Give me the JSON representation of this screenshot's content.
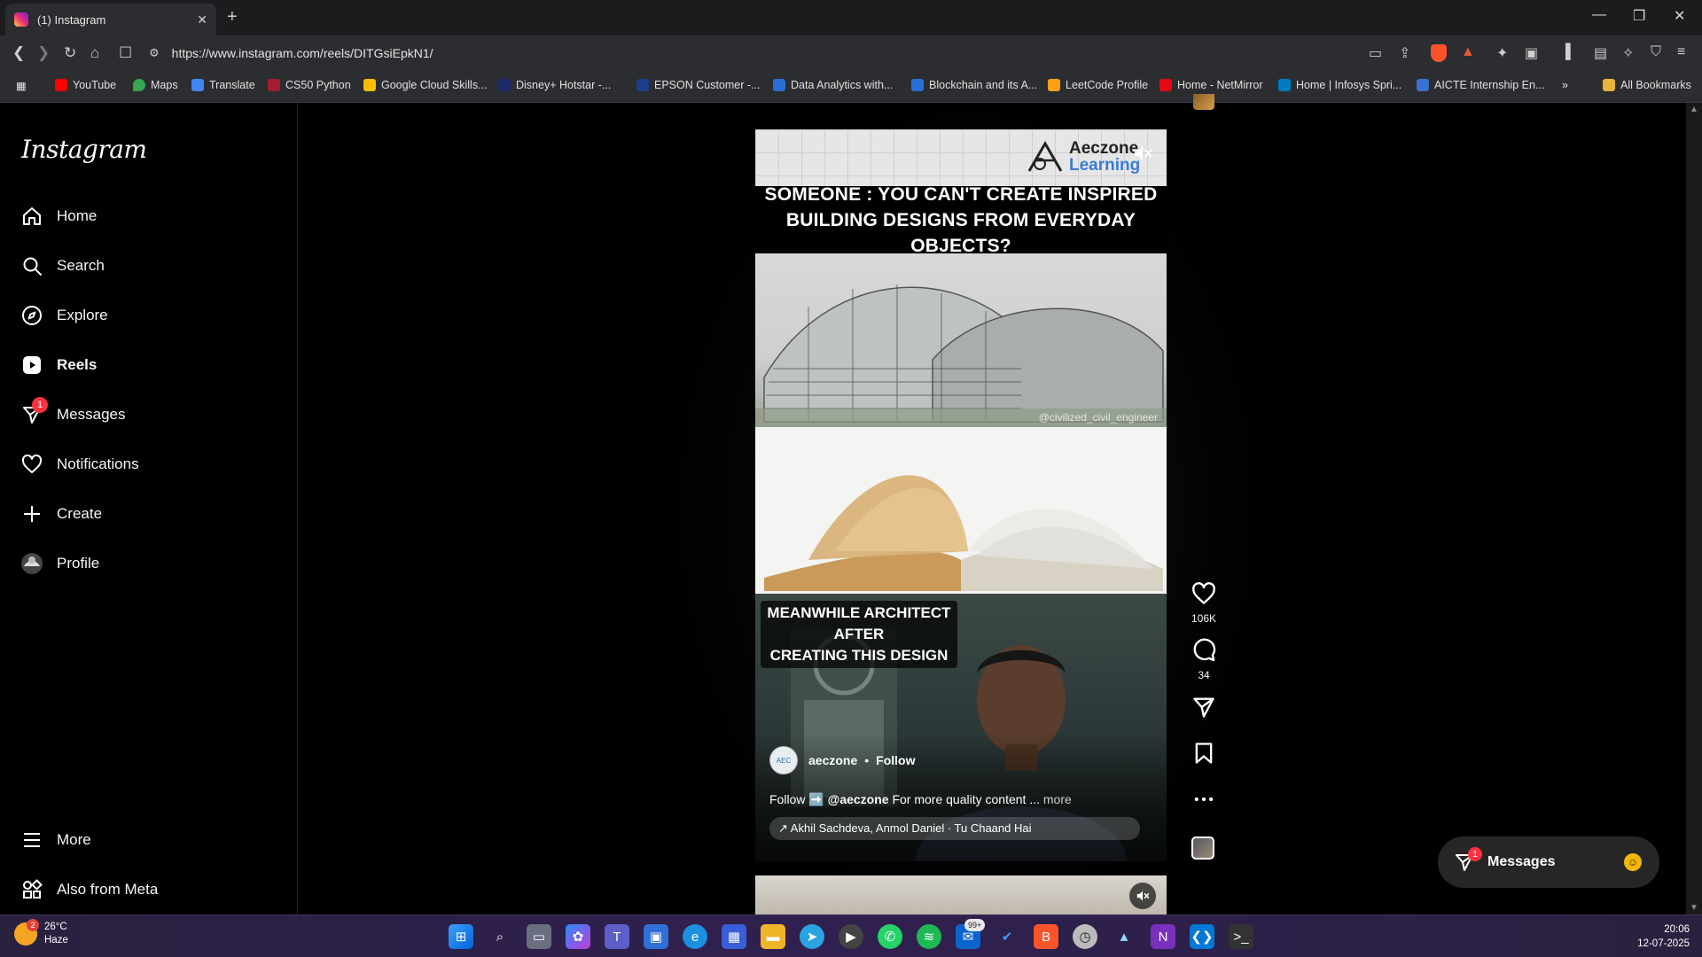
{
  "browser": {
    "tab_title": "(1) Instagram",
    "url": "https://www.instagram.com/reels/DITGsiEpkN1/",
    "bookmarks": [
      {
        "label": "YouTube",
        "color": "#ff0000"
      },
      {
        "label": "Maps",
        "color": "#34a853"
      },
      {
        "label": "Translate",
        "color": "#4285f4"
      },
      {
        "label": "CS50 Python",
        "color": "#a51c30"
      },
      {
        "label": "Google Cloud Skills...",
        "color": "#fbbc05"
      },
      {
        "label": "Disney+ Hotstar -...",
        "color": "#1f2a6b"
      },
      {
        "label": "EPSON Customer -...",
        "color": "#1a3e8c"
      },
      {
        "label": "Data Analytics with...",
        "color": "#2a6fd6"
      },
      {
        "label": "Blockchain and its A...",
        "color": "#2a6fd6"
      },
      {
        "label": "LeetCode Profile",
        "color": "#ffa116"
      },
      {
        "label": "Home - NetMirror",
        "color": "#e50914"
      },
      {
        "label": "Home | Infosys Spri...",
        "color": "#007cc3"
      },
      {
        "label": "AICTE Internship En...",
        "color": "#3b6fd1"
      }
    ],
    "all_bookmarks": "All Bookmarks",
    "brave_badge": "1"
  },
  "instagram": {
    "logo": "Instagram",
    "nav": [
      {
        "label": "Home",
        "icon": "home-icon"
      },
      {
        "label": "Search",
        "icon": "search-icon"
      },
      {
        "label": "Explore",
        "icon": "compass-icon"
      },
      {
        "label": "Reels",
        "icon": "reels-icon"
      },
      {
        "label": "Messages",
        "icon": "messenger-icon",
        "badge": "1"
      },
      {
        "label": "Notifications",
        "icon": "heart-icon"
      },
      {
        "label": "Create",
        "icon": "plus-icon"
      },
      {
        "label": "Profile",
        "icon": "avatar-icon"
      }
    ],
    "more": "More",
    "also_from_meta": "Also from Meta"
  },
  "reel": {
    "brand_line1": "Aeczone",
    "brand_line2": "Learning",
    "headline_line1": "SOMEONE : YOU CAN'T CREATE INSPIRED",
    "headline_line2": "BUILDING DESIGNS FROM EVERYDAY OBJECTS?",
    "credit": "@civilized_civil_engineer",
    "caption_line1": "MEANWHILE ARCHITECT AFTER",
    "caption_line2": "CREATING THIS DESIGN",
    "username": "aeczone",
    "follow": "Follow",
    "desc_prefix": "Follow ➡️",
    "desc_handle": "@aeczone",
    "desc_text": "For more quality content ...",
    "desc_more": "more",
    "audio": "↗ Akhil Sachdeva, Anmol Daniel · Tu Chaand Hai",
    "likes": "106K",
    "comments": "34"
  },
  "messages_pill": {
    "label": "Messages",
    "badge": "1"
  },
  "taskbar": {
    "temp": "26°C",
    "condition": "Haze",
    "weather_badge": "2",
    "mail_badge": "99+",
    "time": "20:06",
    "date": "12-07-2025"
  }
}
